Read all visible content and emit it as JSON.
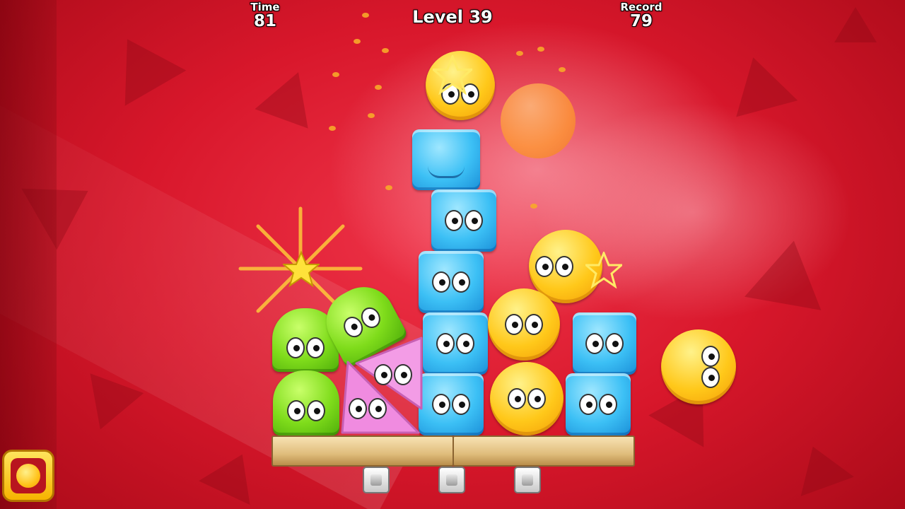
{
  "hud": {
    "time_label": "Time",
    "time_value": "81",
    "level_text": "Level 39",
    "record_label": "Record",
    "record_value": "79"
  },
  "pieces": {
    "blue": "#3cc0f5",
    "green": "#7fdc1b",
    "yellow": "#ffc81a",
    "pink": "#f08be0",
    "orange": "#ff9a2e"
  },
  "icons": {
    "star": "star-icon",
    "powerup": "yellow-blob-icon"
  },
  "colors": {
    "background": "#d8172b",
    "plank": "#e0bd7c",
    "hud_text": "#ffffff"
  }
}
